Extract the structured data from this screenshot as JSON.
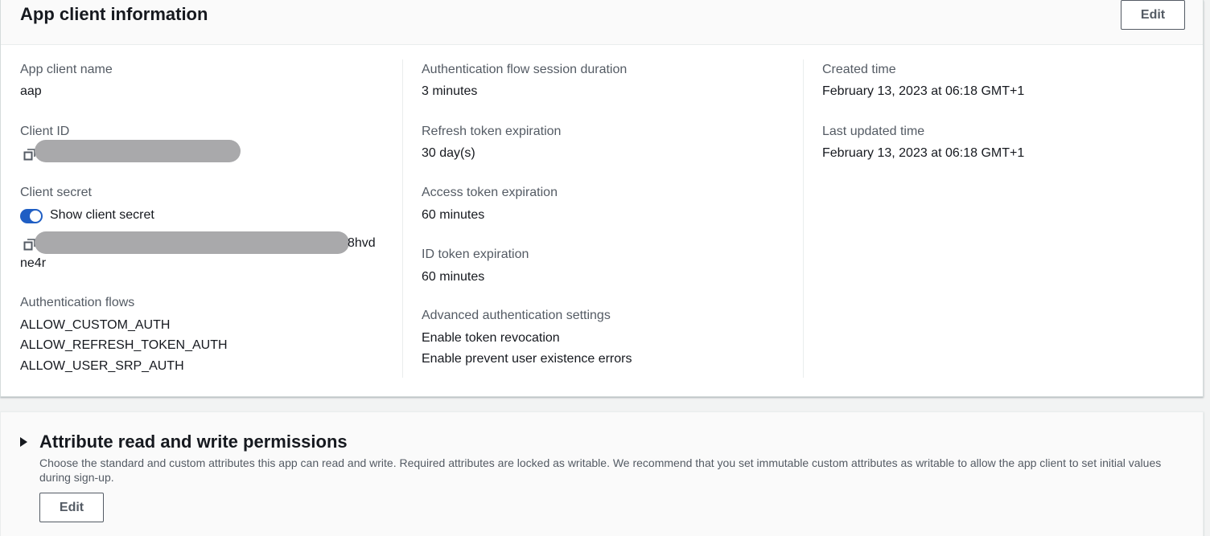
{
  "app_client": {
    "title": "App client information",
    "edit_label": "Edit",
    "col1": {
      "client_name_label": "App client name",
      "client_name_value": "aap",
      "client_id_label": "Client ID",
      "client_secret_label": "Client secret",
      "show_secret_label": "Show client secret",
      "show_secret_on": true,
      "secret_visible_suffix": "8hvd",
      "secret_line2": "ne4r",
      "auth_flows_label": "Authentication flows",
      "auth_flows": [
        "ALLOW_CUSTOM_AUTH",
        "ALLOW_REFRESH_TOKEN_AUTH",
        "ALLOW_USER_SRP_AUTH"
      ]
    },
    "col2": {
      "session_duration_label": "Authentication flow session duration",
      "session_duration_value": "3 minutes",
      "refresh_label": "Refresh token expiration",
      "refresh_value": "30 day(s)",
      "access_label": "Access token expiration",
      "access_value": "60 minutes",
      "id_label": "ID token expiration",
      "id_value": "60 minutes",
      "advanced_label": "Advanced authentication settings",
      "advanced_values": [
        "Enable token revocation",
        "Enable prevent user existence errors"
      ]
    },
    "col3": {
      "created_label": "Created time",
      "created_value": "February 13, 2023 at 06:18 GMT+1",
      "updated_label": "Last updated time",
      "updated_value": "February 13, 2023 at 06:18 GMT+1"
    }
  },
  "attributes": {
    "title": "Attribute read and write permissions",
    "description": "Choose the standard and custom attributes this app can read and write. Required attributes are locked as writable. We recommend that you set immutable custom attributes as writable to allow the app client to set initial values during sign-up.",
    "edit_label": "Edit"
  },
  "colors": {
    "toggle_on": "#1f5ec4",
    "redaction": "#a9a9ab",
    "label_gray": "#545b64",
    "text": "#16191f"
  },
  "icons": [
    "copy-icon",
    "caret-right-icon"
  ]
}
